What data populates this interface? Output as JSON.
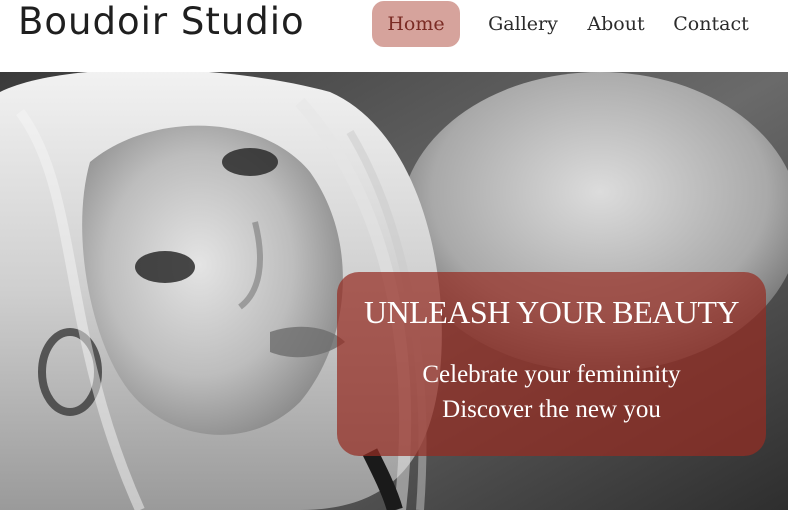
{
  "header": {
    "brand": "Boudoir Studio",
    "nav": [
      {
        "label": "Home",
        "active": true
      },
      {
        "label": "Gallery",
        "active": false
      },
      {
        "label": "About",
        "active": false
      },
      {
        "label": "Contact",
        "active": false
      }
    ]
  },
  "hero": {
    "title": "UNLEASH YOUR BEAUTY",
    "line1": "Celebrate your femininity",
    "line2": "Discover the new you"
  },
  "colors": {
    "nav_active_bg": "#d6a39c",
    "nav_active_text": "#7a2b24",
    "cta_bg": "#962c22"
  }
}
